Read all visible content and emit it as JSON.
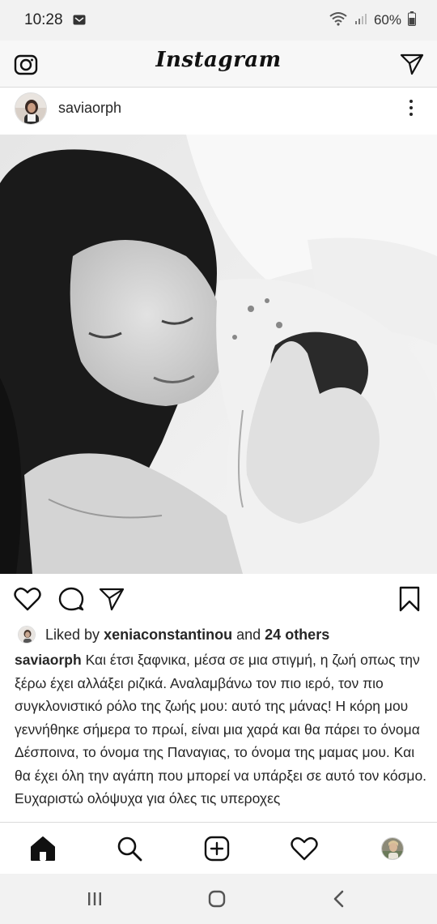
{
  "status_bar": {
    "time": "10:28",
    "battery": "60%",
    "icons": [
      "message-icon",
      "wifi-icon",
      "signal-icon",
      "battery-icon"
    ]
  },
  "top_bar": {
    "logo": "Instagram",
    "icons": [
      "camera-icon",
      "direct-send-icon"
    ]
  },
  "post": {
    "username": "saviaorph",
    "image_alt_colors": {
      "light": "#ececec",
      "dark": "#1c1c1c"
    },
    "actions": [
      "heart-icon",
      "comment-icon",
      "share-icon",
      "bookmark-icon"
    ],
    "likes": {
      "prefix": "Liked by",
      "user": "xeniaconstantinou",
      "middle": "and",
      "others": "24 others"
    },
    "caption": {
      "username": "saviaorph",
      "text": "Και έτσι ξαφνικα, μέσα σε μια στιγμή, η ζωή οπως την ξέρω έχει αλλάξει ριζικά. Αναλαμβάνω τον πιο ιερό, τον πιο συγκλονιστικό ρόλο της ζωής μου: αυτό της μάνας! Η κόρη μου γεννήθηκε σήμερα το πρωί, είναι μια χαρά και θα πάρει το όνομα Δέσποινα, το όνομα της Παναγιας, το όνομα της μαμας μου. Και θα έχει όλη την αγάπη που μπορεί να υπάρξει σε αυτό τον κόσμο. Ευχαριστώ ολόψυχα για όλες τις υπεροχες"
    }
  },
  "bottom_nav": {
    "items": [
      "home-icon",
      "search-icon",
      "new-post-icon",
      "activity-icon",
      "profile-avatar"
    ]
  },
  "system_nav": {
    "items": [
      "recent-apps-icon",
      "home-circle-icon",
      "back-icon"
    ]
  }
}
